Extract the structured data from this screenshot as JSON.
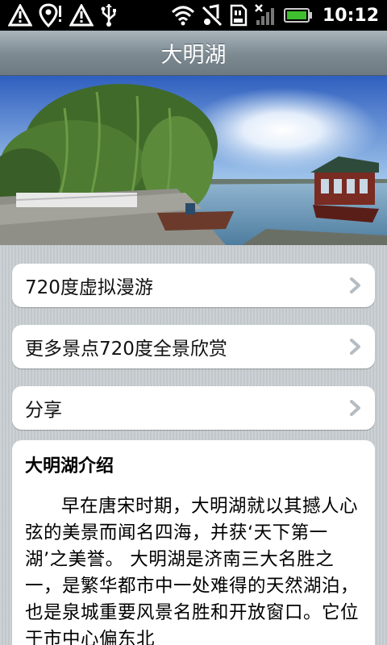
{
  "status_bar": {
    "time": "10:12",
    "left_icons": [
      "warning-icon",
      "location-alert-icon",
      "warning-icon",
      "usb-icon"
    ],
    "right_icons": [
      "wifi-icon",
      "music-off-icon",
      "sd-card-icon",
      "no-signal-icon",
      "battery-icon"
    ]
  },
  "title_bar": {
    "title": "大明湖"
  },
  "panorama": {
    "icon": "lake-panorama-photo"
  },
  "menu": [
    {
      "label": "720度虚拟漫游",
      "icon": "chevron-right-icon"
    },
    {
      "label": "更多景点720度全景欣赏",
      "icon": "chevron-right-icon"
    },
    {
      "label": "分享",
      "icon": "chevron-right-icon"
    }
  ],
  "intro": {
    "heading": "大明湖介绍",
    "body": "早在唐宋时期，大明湖就以其撼人心弦的美景而闻名四海，并获‘天下第一湖’之美誉。 大明湖是济南三大名胜之一，是繁华都市中一处难得的天然湖泊，也是泉城重要风景名胜和开放窗口。它位于市中心偏东北"
  },
  "colors": {
    "title_bar": "#7c8991",
    "background": "#c7cdd0",
    "battery": "#3fbf2f"
  }
}
